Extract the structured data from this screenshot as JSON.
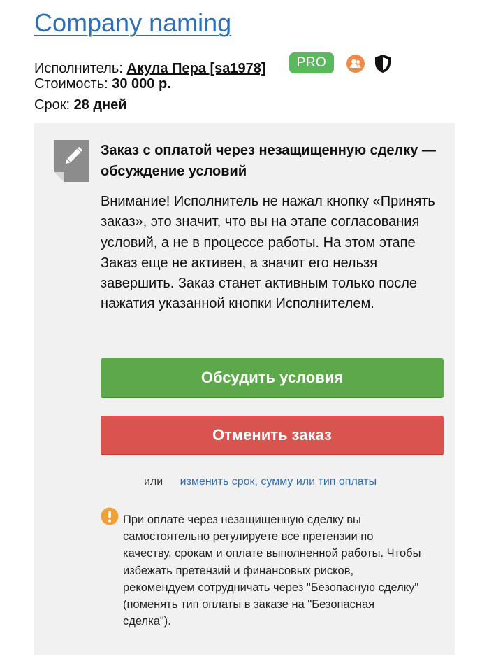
{
  "header": {
    "title": "Company naming"
  },
  "meta": {
    "executor_label": "Исполнитель:",
    "executor_name": "Акула Пера [sa1978]",
    "pro_badge": "PRO",
    "cost_label": "Стоимость:",
    "cost_value": "30 000 р.",
    "term_label": "Срок:",
    "term_value": "28 дней",
    "icons": [
      "user-icon",
      "shield-icon"
    ]
  },
  "panel": {
    "icon": "edit-pencil-icon",
    "heading": "Заказ с оплатой через незащищенную сделку — обсуждение условий",
    "warning_text": "Внимание! Исполнитель не нажал кнопку «Принять заказ», это значит, что вы на этапе согласования условий, а не в процессе работы. На этом этапе Заказ еще не активен, а значит его нельзя завершить. Заказ станет активным только после нажатия указанной кнопки Исполнителем.",
    "discuss_button": "Обсудить условия",
    "cancel_button": "Отменить заказ",
    "or_word": "или",
    "change_link": "изменить срок, сумму или тип оплаты",
    "notice_icon": "exclamation-icon",
    "notice_text": "При оплате через незащищенную сделку вы самостоятельно регулируете все претензии по качеству, срокам и оплате выполненной работы. Чтобы избежать претензий и финансовых рисков, рекомендуем сотрудничать через \"Безопасную сделку\" (поменять тип оплаты в заказе на \"Безопасная сделка\")."
  },
  "colors": {
    "link_blue": "#2f6fb4",
    "pro_green": "#5cb85c",
    "button_green": "#5ca84a",
    "button_red": "#d9534f",
    "panel_bg": "#f1f1f1",
    "warn_orange": "#f0a03a"
  }
}
